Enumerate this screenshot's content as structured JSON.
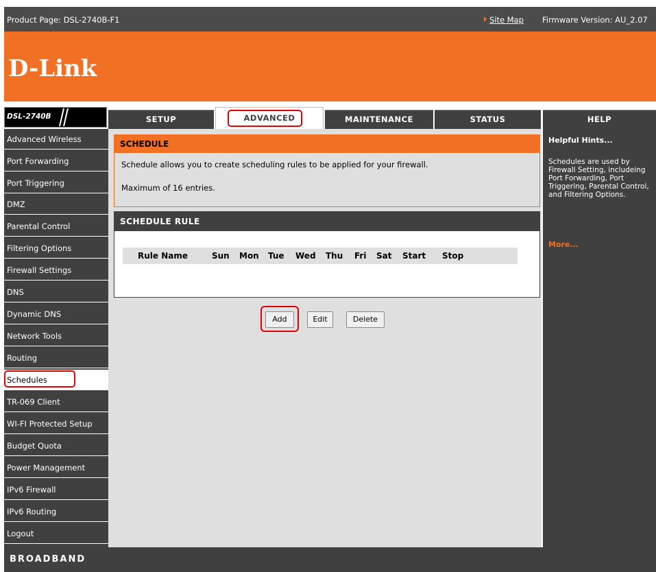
{
  "header": {
    "product_page": "Product Page: DSL-2740B-F1",
    "site_map": "Site Map",
    "firmware": "Firmware Version: AU_2.07"
  },
  "brand": {
    "logo": "D-Link",
    "model": "DSL-2740B",
    "accent_color": "#f27024"
  },
  "tabs": [
    {
      "label": "SETUP"
    },
    {
      "label": "ADVANCED",
      "active": true
    },
    {
      "label": "MAINTENANCE"
    },
    {
      "label": "STATUS"
    },
    {
      "label": "HELP"
    }
  ],
  "sidebar": {
    "items": [
      {
        "label": "Advanced Wireless"
      },
      {
        "label": "Port Forwarding"
      },
      {
        "label": "Port Triggering"
      },
      {
        "label": "DMZ"
      },
      {
        "label": "Parental Control"
      },
      {
        "label": "Filtering Options"
      },
      {
        "label": "Firewall Settings"
      },
      {
        "label": "DNS"
      },
      {
        "label": "Dynamic DNS"
      },
      {
        "label": "Network Tools"
      },
      {
        "label": "Routing"
      },
      {
        "label": "Schedules",
        "active": true
      },
      {
        "label": "TR-069 Client"
      },
      {
        "label": "WI-FI Protected Setup"
      },
      {
        "label": "Budget Quota"
      },
      {
        "label": "Power Management"
      },
      {
        "label": "IPv6 Firewall"
      },
      {
        "label": "IPv6 Routing"
      },
      {
        "label": "Logout"
      }
    ]
  },
  "schedule": {
    "title": "SCHEDULE",
    "description": "Schedule allows you to create scheduling rules to be applied for your firewall.",
    "max_entries": "Maximum of 16 entries."
  },
  "schedule_rule": {
    "title": "SCHEDULE RULE",
    "columns": [
      "Rule Name",
      "Sun",
      "Mon",
      "Tue",
      "Wed",
      "Thu",
      "Fri",
      "Sat",
      "Start",
      "Stop"
    ]
  },
  "buttons": {
    "add": "Add",
    "edit": "Edit",
    "delete": "Delete"
  },
  "help": {
    "title": "Helpful Hints...",
    "text": "Schedules are used by Firewall Setting, includeing Port Forwarding, Port Triggering, Parental Control, and Filtering Options.",
    "more": "More..."
  },
  "footer": {
    "label": "BROADBAND"
  }
}
